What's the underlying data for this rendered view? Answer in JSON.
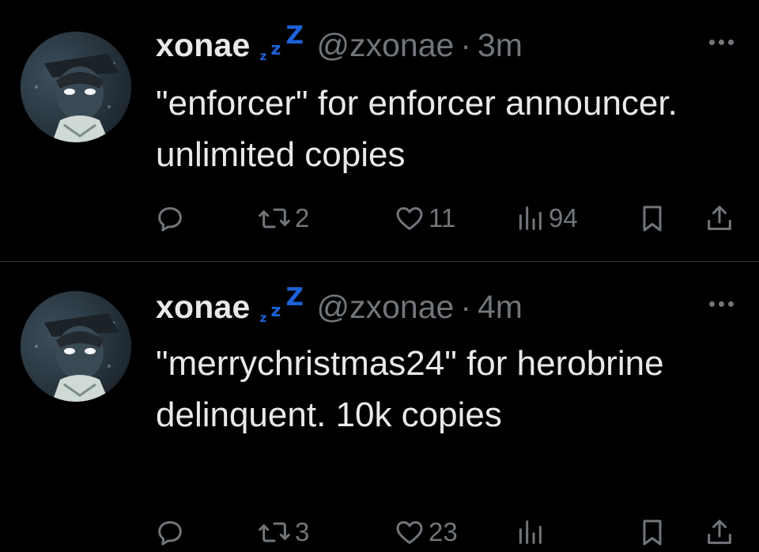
{
  "tweets": [
    {
      "display_name": "xonae",
      "status_emoji": "zzz",
      "handle": "@zxonae",
      "separator": "·",
      "time": "3m",
      "text": "\"enforcer\" for enforcer announcer. unlimited copies",
      "replies": "",
      "retweets": "2",
      "likes": "11",
      "views": "94"
    },
    {
      "display_name": "xonae",
      "status_emoji": "zzz",
      "handle": "@zxonae",
      "separator": "·",
      "time": "4m",
      "text": "\"merrychristmas24\" for herobrine delinquent. 10k copies",
      "replies": "",
      "retweets": "3",
      "likes": "23",
      "views": ""
    }
  ],
  "icons": {
    "reply": "reply-icon",
    "retweet": "retweet-icon",
    "like": "heart-icon",
    "views": "views-icon",
    "bookmark": "bookmark-icon",
    "share": "share-icon",
    "more": "more-icon",
    "status": "sleeping-icon"
  },
  "colors": {
    "background": "#000000",
    "text": "#e7e9ea",
    "secondary": "#71767b",
    "divider": "#2f3336",
    "status_emoji": "#1d62d8"
  }
}
